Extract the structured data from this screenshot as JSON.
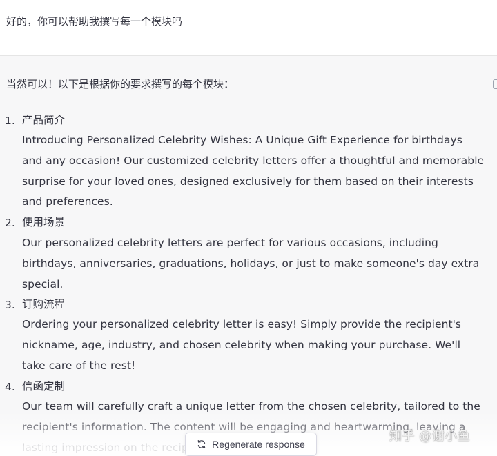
{
  "user_message": {
    "text": "好的，你可以帮助我撰写每一个模块吗"
  },
  "assistant_message": {
    "intro": "当然可以！以下是根据你的要求撰写的每个模块：",
    "sections": [
      {
        "number": "1.",
        "title": "产品简介",
        "body": "Introducing Personalized Celebrity Wishes: A Unique Gift Experience for birthdays and any occasion! Our customized celebrity letters offer a thoughtful and memorable surprise for your loved ones, designed exclusively for them based on their interests and preferences."
      },
      {
        "number": "2.",
        "title": "使用场景",
        "body": "Our personalized celebrity letters are perfect for various occasions, including birthdays, anniversaries, graduations, holidays, or just to make someone's day extra special."
      },
      {
        "number": "3.",
        "title": "订购流程",
        "body": "Ordering your personalized celebrity letter is easy! Simply provide the recipient's nickname, age, industry, and chosen celebrity when making your purchase. We'll take care of the rest!"
      },
      {
        "number": "4.",
        "title": "信函定制",
        "body": "Our team will carefully craft a unique letter from the chosen celebrity, tailored to the recipient's information. The content will be engaging and heartwarming, leaving a lasting impression on the recipient."
      }
    ]
  },
  "regenerate_button": {
    "label": "Regenerate response",
    "icon": "refresh-icon"
  },
  "watermark": {
    "text": "知乎 @谢小鱼"
  }
}
